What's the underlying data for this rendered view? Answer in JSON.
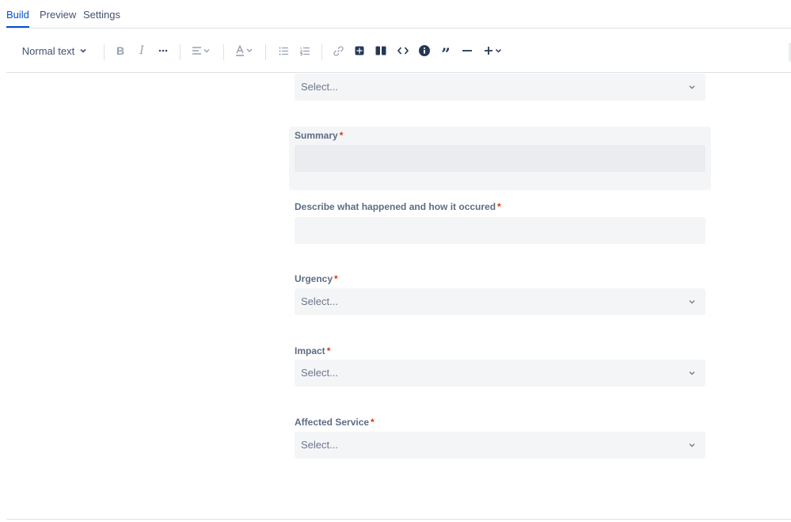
{
  "tabs": [
    {
      "label": "Build",
      "active": true
    },
    {
      "label": "Preview",
      "active": false
    },
    {
      "label": "Settings",
      "active": false
    }
  ],
  "toolbar": {
    "text_style": "Normal text",
    "items": [
      "bold-icon",
      "italic-icon",
      "more-formatting-icon",
      "align-icon",
      "text-color-icon",
      "bullet-list-icon",
      "numbered-list-icon",
      "link-icon",
      "table-icon",
      "layout-icon",
      "code-icon",
      "info-panel-icon",
      "quote-icon",
      "divider-icon",
      "insert-plus-icon"
    ]
  },
  "form": {
    "top_select": {
      "placeholder": "Select..."
    },
    "summary": {
      "label": "Summary",
      "required_mark": "*"
    },
    "describe": {
      "label": "Describe what happened and how it occured",
      "required_mark": "*"
    },
    "urgency": {
      "label": "Urgency",
      "required_mark": "*",
      "placeholder": "Select..."
    },
    "impact": {
      "label": "Impact",
      "required_mark": "*",
      "placeholder": "Select..."
    },
    "affected_service": {
      "label": "Affected Service",
      "required_mark": "*",
      "placeholder": "Select..."
    }
  },
  "colors": {
    "accent": "#0052cc",
    "required": "#de350b",
    "field_bg": "#f4f5f7",
    "label": "#5e6c84"
  }
}
